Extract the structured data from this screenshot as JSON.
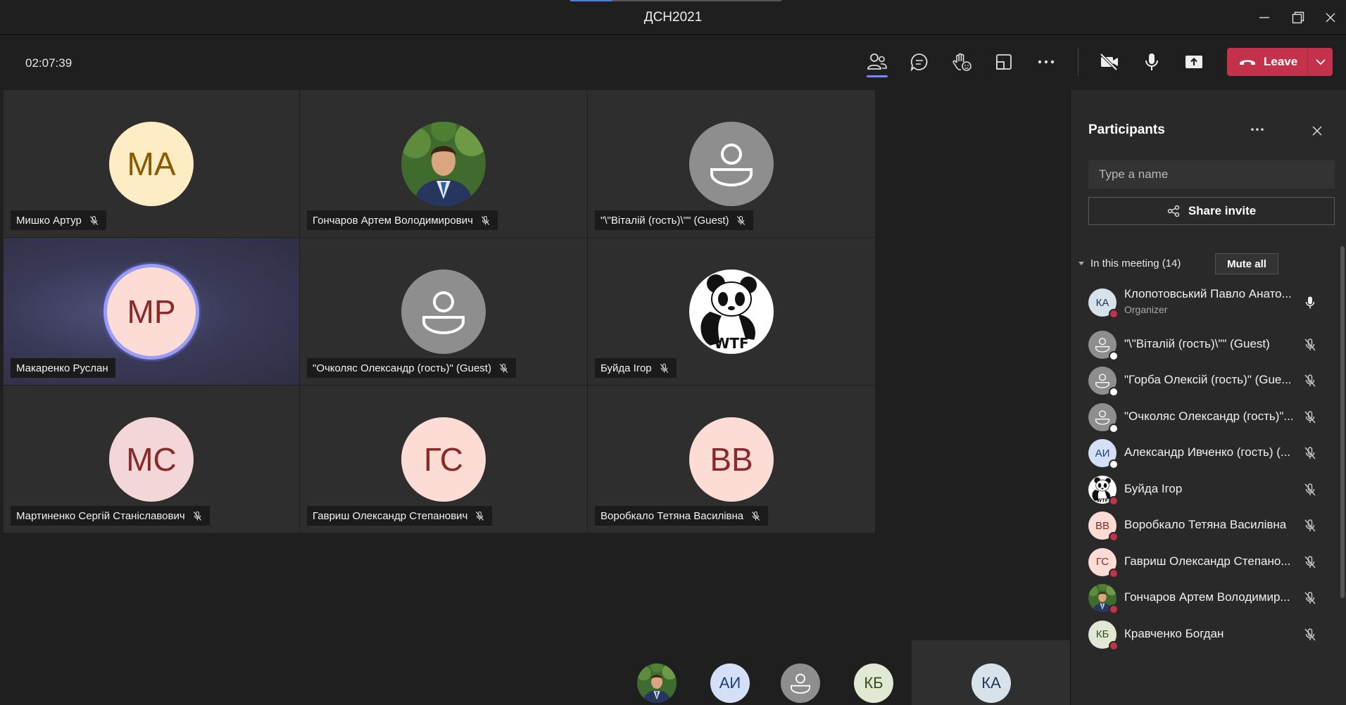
{
  "window": {
    "title": "ДСН2021",
    "progress": 0.2
  },
  "toolbar": {
    "timer": "02:07:39",
    "leave_label": "Leave"
  },
  "colors": {
    "accent": "#7f85f5",
    "leave": "#c4314b",
    "muted_dot": "#c4314b",
    "guest_dot": "#ffffff"
  },
  "tiles": [
    {
      "name": "Мишко Артур",
      "initials": "MA",
      "avatar_type": "initials",
      "avatar_bg": "#fdecc4",
      "avatar_fg": "#8a5a00"
    },
    {
      "name": "Гончаров Артем Володимирович",
      "initials": "",
      "avatar_type": "photo"
    },
    {
      "name": "\"\\\"Віталій (гость)\\\"\" (Guest)",
      "initials": "",
      "avatar_type": "guest"
    },
    {
      "name": "Макаренко Руслан",
      "initials": "MP",
      "avatar_type": "initials",
      "avatar_bg": "#fcdcd4",
      "avatar_fg": "#8a2a28",
      "speaking": true
    },
    {
      "name": "\"Очколяс Олександр (гость)\" (Guest)",
      "initials": "",
      "avatar_type": "guest"
    },
    {
      "name": "Буйда Ігор",
      "initials": "",
      "avatar_type": "panda"
    },
    {
      "name": "Мартиненко Сергій Станіславович",
      "initials": "MC",
      "avatar_type": "initials",
      "avatar_bg": "#f3d7d8",
      "avatar_fg": "#8a2a28"
    },
    {
      "name": "Гавриш Олександр Степанович",
      "initials": "ГС",
      "avatar_type": "initials",
      "avatar_bg": "#fcdcd4",
      "avatar_fg": "#8a2a28"
    },
    {
      "name": "Воробкало Тетяна Василівна",
      "initials": "BB",
      "avatar_type": "initials",
      "avatar_bg": "#fcdcd4",
      "avatar_fg": "#8a2a28"
    }
  ],
  "strip": [
    {
      "initials": "",
      "type": "photo"
    },
    {
      "initials": "АИ",
      "type": "initials",
      "bg": "#d4e0f7",
      "fg": "#1b3f7a"
    },
    {
      "initials": "",
      "type": "guest"
    },
    {
      "initials": "КБ",
      "type": "initials",
      "bg": "#e1e8d4",
      "fg": "#3b4a1e"
    },
    {
      "initials": "КА",
      "type": "initials",
      "bg": "#d7e2ea",
      "fg": "#213a52"
    }
  ],
  "panel": {
    "title": "Participants",
    "search_placeholder": "Type a name",
    "share_label": "Share invite",
    "section_label": "In this meeting (14)",
    "mute_all_label": "Mute all",
    "participants": [
      {
        "name": "Клопотовський Павло Анато...",
        "role": "Organizer",
        "initials": "КА",
        "type": "initials",
        "bg": "#d7e2ea",
        "fg": "#213a52",
        "status": "red",
        "mic": "on"
      },
      {
        "name": "\"\\\"Віталій (гость)\\\"\" (Guest)",
        "role": "",
        "initials": "",
        "type": "guest",
        "status": "white",
        "mic": "off"
      },
      {
        "name": "\"Горба Олексій (гость)\" (Gue...",
        "role": "",
        "initials": "",
        "type": "guest",
        "status": "white",
        "mic": "off"
      },
      {
        "name": "\"Очколяс Олександр (гость)\"...",
        "role": "",
        "initials": "",
        "type": "guest",
        "status": "white",
        "mic": "off"
      },
      {
        "name": "Александр Ивченко (гость) (...",
        "role": "",
        "initials": "АИ",
        "type": "initials",
        "bg": "#d4e0f7",
        "fg": "#1b3f7a",
        "status": "white",
        "mic": "off"
      },
      {
        "name": "Буйда Ігор",
        "role": "",
        "initials": "",
        "type": "panda",
        "status": "red",
        "mic": "off"
      },
      {
        "name": "Воробкало Тетяна Василівна",
        "role": "",
        "initials": "BB",
        "type": "initials",
        "bg": "#fcdcd4",
        "fg": "#8a2a28",
        "status": "red",
        "mic": "off"
      },
      {
        "name": "Гавриш Олександр Степано...",
        "role": "",
        "initials": "ГС",
        "type": "initials",
        "bg": "#fcdcd4",
        "fg": "#8a2a28",
        "status": "red",
        "mic": "off"
      },
      {
        "name": "Гончаров Артем Володимир...",
        "role": "",
        "initials": "",
        "type": "photo",
        "status": "red",
        "mic": "off"
      },
      {
        "name": "Кравченко Богдан",
        "role": "",
        "initials": "КБ",
        "type": "initials",
        "bg": "#e1e8d4",
        "fg": "#3b4a1e",
        "status": "red",
        "mic": "off"
      }
    ]
  }
}
